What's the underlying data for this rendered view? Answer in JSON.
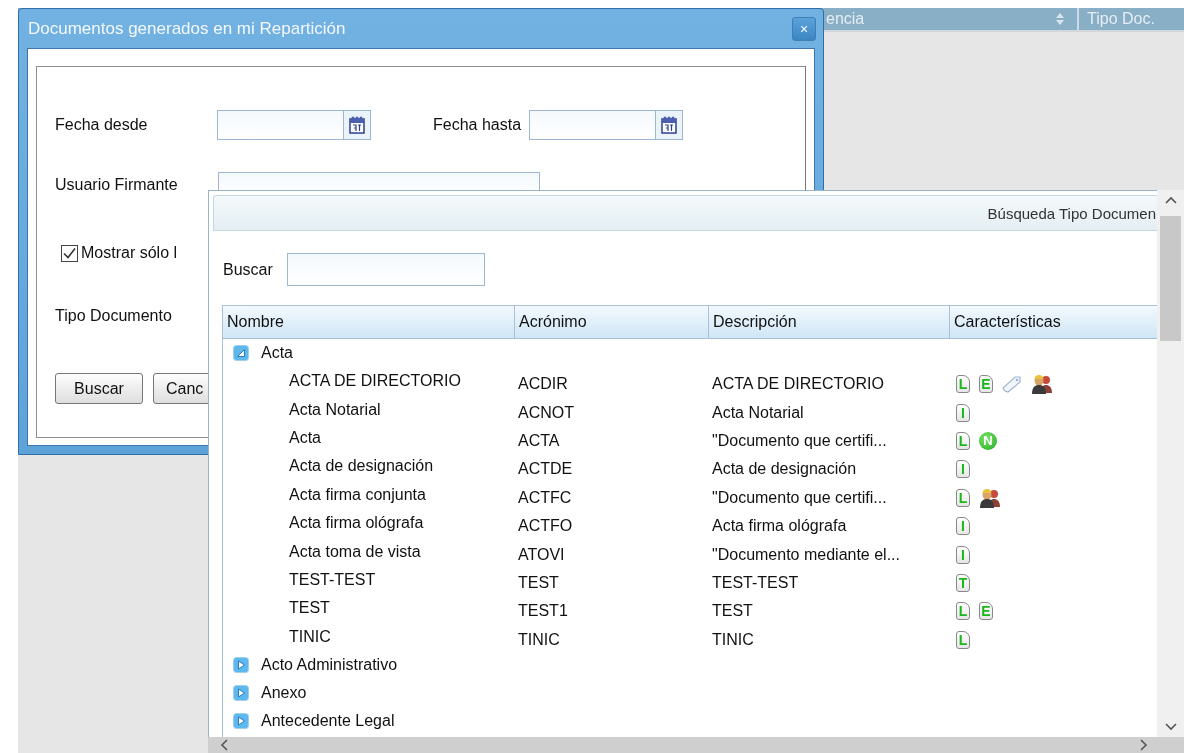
{
  "background": {
    "columns": [
      {
        "label": "encia",
        "sortable": true
      },
      {
        "label": "Tipo Doc.",
        "sortable": false
      }
    ]
  },
  "filter_dialog": {
    "title": "Documentos generados en mi Repartición",
    "close": "×",
    "fields": [
      {
        "label": "Fecha desde",
        "kind": "date"
      },
      {
        "label": "Fecha hasta",
        "kind": "date"
      },
      {
        "label": "Usuario Firmante",
        "kind": "text"
      }
    ],
    "checkbox": {
      "label": "Mostrar sólo l",
      "checked": true
    },
    "type_label": "Tipo Documento",
    "buttons": [
      "Buscar",
      "Canc"
    ]
  },
  "type_dialog": {
    "title": "Búsqueda Tipo Documen",
    "search_label": "Buscar",
    "table": {
      "columns": [
        "Nombre",
        "Acrónimo",
        "Descripción",
        "Características"
      ],
      "groups": [
        {
          "name": "Acta",
          "expanded": true,
          "children": [
            {
              "name": "ACTA DE DIRECTORIO",
              "acronym": "ACDIR",
              "description": "ACTA DE DIRECTORIO",
              "features": [
                {
                  "kind": "doc",
                  "text": "L"
                },
                {
                  "kind": "doc",
                  "text": "E"
                },
                {
                  "kind": "tag"
                },
                {
                  "kind": "users"
                }
              ]
            },
            {
              "name": "Acta Notarial",
              "acronym": "ACNOT",
              "description": "Acta Notarial",
              "features": [
                {
                  "kind": "doc",
                  "text": "I"
                }
              ]
            },
            {
              "name": "Acta",
              "acronym": "ACTA",
              "description": "\"Documento que certifi...",
              "features": [
                {
                  "kind": "doc",
                  "text": "L"
                },
                {
                  "kind": "circle",
                  "text": "N"
                }
              ]
            },
            {
              "name": "Acta de designación",
              "acronym": "ACTDE",
              "description": "Acta de designación",
              "features": [
                {
                  "kind": "doc",
                  "text": "I"
                }
              ]
            },
            {
              "name": "Acta firma conjunta",
              "acronym": "ACTFC",
              "description": "\"Documento que certifi...",
              "features": [
                {
                  "kind": "doc",
                  "text": "L"
                },
                {
                  "kind": "users"
                }
              ]
            },
            {
              "name": "Acta firma ológrafa",
              "acronym": "ACTFO",
              "description": "Acta firma ológrafa",
              "features": [
                {
                  "kind": "doc",
                  "text": "I"
                }
              ]
            },
            {
              "name": "Acta toma de vista",
              "acronym": "ATOVI",
              "description": "\"Documento mediante el...",
              "features": [
                {
                  "kind": "doc",
                  "text": "I"
                }
              ]
            },
            {
              "name": "TEST-TEST",
              "acronym": "TEST",
              "description": "TEST-TEST",
              "features": [
                {
                  "kind": "doc",
                  "text": "T"
                }
              ]
            },
            {
              "name": "TEST",
              "acronym": "TEST1",
              "description": "TEST",
              "features": [
                {
                  "kind": "doc",
                  "text": "L"
                },
                {
                  "kind": "doc",
                  "text": "E"
                }
              ]
            },
            {
              "name": "TINIC",
              "acronym": "TINIC",
              "description": "TINIC",
              "features": [
                {
                  "kind": "doc",
                  "text": "L"
                }
              ]
            }
          ]
        },
        {
          "name": "Acto Administrativo",
          "expanded": false
        },
        {
          "name": "Anexo",
          "expanded": false
        },
        {
          "name": "Antecedente Legal",
          "expanded": false
        }
      ]
    }
  }
}
